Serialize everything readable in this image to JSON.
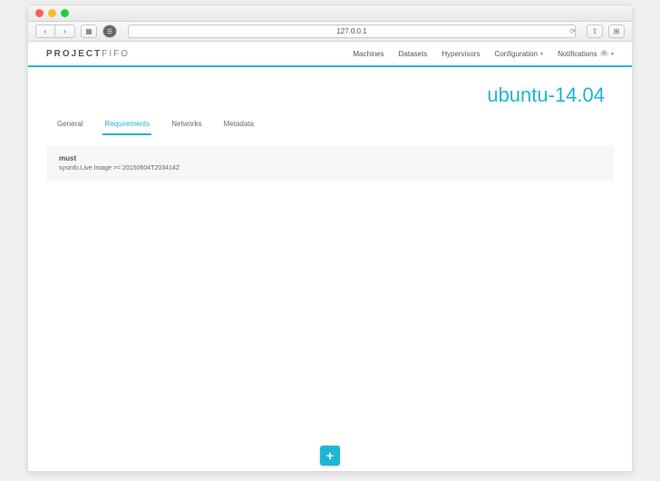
{
  "browser": {
    "url": "127.0.0.1"
  },
  "brand": {
    "part1": "PROJECT",
    "part2": "FIFO"
  },
  "nav": {
    "machines": "Machines",
    "datasets": "Datasets",
    "hypervisors": "Hypervisors",
    "configuration": "Configuration",
    "notifications": "Notifications",
    "notif_count": "0"
  },
  "page": {
    "title": "ubuntu-14.04"
  },
  "tabs": {
    "general": "General",
    "requirements": "Requirements",
    "networks": "Networks",
    "metadata": "Metadata"
  },
  "requirement": {
    "label": "must",
    "text": "sysinfo.Live Image >= 20150604T203414Z"
  },
  "fab": {
    "label": "+"
  }
}
